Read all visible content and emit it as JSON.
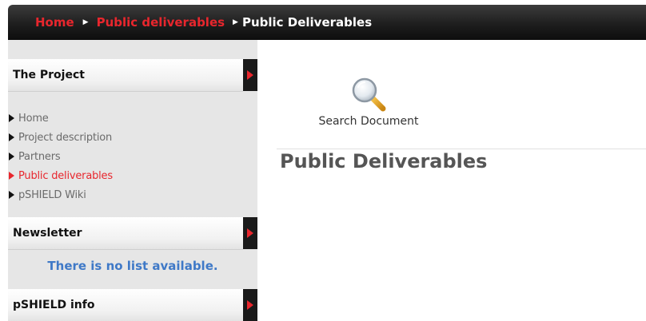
{
  "breadcrumb": {
    "items": [
      {
        "label": "Home"
      },
      {
        "label": "Public deliverables"
      }
    ],
    "current": "Public Deliverables",
    "separator": "▶"
  },
  "sidebar": {
    "project_module": {
      "title": "The Project",
      "items": [
        {
          "label": "Home",
          "active": false
        },
        {
          "label": "Project description",
          "active": false
        },
        {
          "label": "Partners",
          "active": false
        },
        {
          "label": "Public deliverables",
          "active": true
        },
        {
          "label": "pSHIELD Wiki",
          "active": false
        }
      ]
    },
    "newsletter_module": {
      "title": "Newsletter",
      "message": "There is no list available."
    },
    "info_module": {
      "title": "pSHIELD info"
    }
  },
  "main": {
    "search_document": {
      "label": "Search Document",
      "icon": "magnifier-icon"
    },
    "page_title": "Public Deliverables"
  },
  "colors": {
    "accent_red": "#e8262d",
    "header_dark": "#1e1e1e",
    "newsletter_blue": "#3f79c7",
    "sidebar_bg": "#e6e6e6",
    "title_gray": "#555555"
  }
}
